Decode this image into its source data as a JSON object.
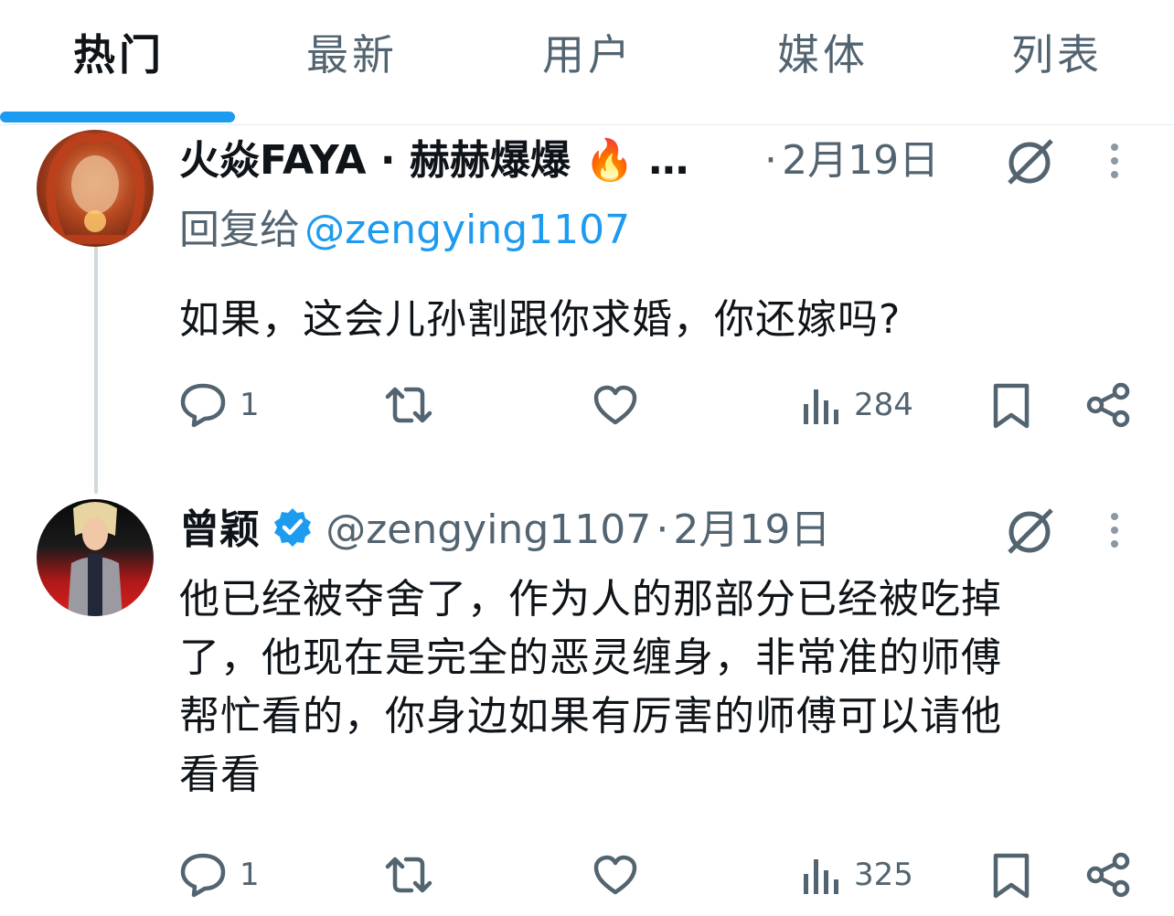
{
  "tabs": [
    {
      "label": "热门",
      "active": true
    },
    {
      "label": "最新",
      "active": false
    },
    {
      "label": "用户",
      "active": false
    },
    {
      "label": "媒体",
      "active": false
    },
    {
      "label": "列表",
      "active": false
    }
  ],
  "posts": [
    {
      "display_name": "火焱FAYA · 赫赫爆爆 🔥 …",
      "separator": "·",
      "date": "2月19日",
      "reply_prefix": "回复给",
      "reply_handle": "@zengying1107",
      "text": "如果，这会儿孙割跟你求婚，你还嫁吗?",
      "replies": "1",
      "views": "284"
    },
    {
      "display_name": "曾颖",
      "handle": "@zengying1107",
      "separator": "·",
      "date": "2月19日",
      "text_lines": [
        "他已经被夺舍了，作为人的那部分已经被吃掉",
        "了，他现在是完全的恶灵缠身，非常准的师傅",
        "帮忙看的，你身边如果有厉害的师傅可以请他",
        "看看"
      ],
      "replies": "1",
      "views": "325"
    }
  ],
  "colors": {
    "accent": "#1d9bf0",
    "secondary_text": "#536471",
    "primary_text": "#0f1419"
  }
}
